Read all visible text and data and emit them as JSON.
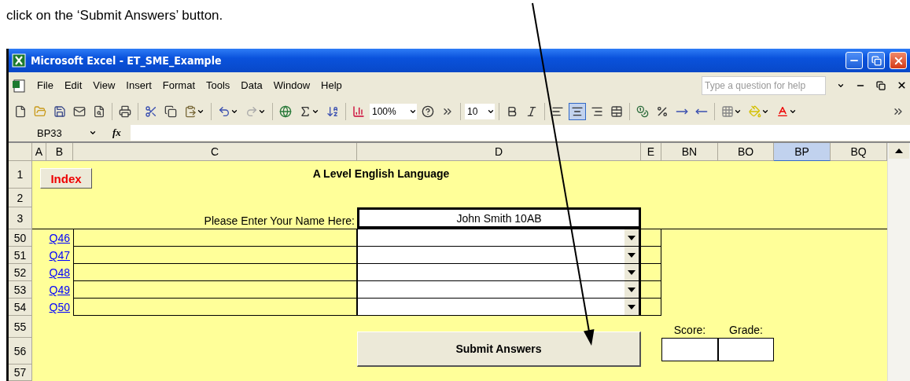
{
  "caption": "click on the ‘Submit Answers’ button.",
  "window": {
    "title": "Microsoft Excel - ET_SME_Example"
  },
  "menu": {
    "items": [
      "File",
      "Edit",
      "View",
      "Insert",
      "Format",
      "Tools",
      "Data",
      "Window",
      "Help"
    ],
    "help_placeholder": "Type a question for help"
  },
  "toolbar": {
    "zoom": "100%",
    "font_size": "10",
    "alignment": [
      {
        "selected": false
      },
      {
        "selected": true
      },
      {
        "selected": false
      }
    ]
  },
  "formula_bar": {
    "name_box": "BP33",
    "fx": "fx"
  },
  "columns": [
    {
      "label": "A",
      "selected": false
    },
    {
      "label": "B",
      "selected": false
    },
    {
      "label": "C",
      "selected": false
    },
    {
      "label": "D",
      "selected": false
    },
    {
      "label": "E",
      "selected": false
    },
    {
      "label": "BN",
      "selected": false
    },
    {
      "label": "BO",
      "selected": false
    },
    {
      "label": "BP",
      "selected": true
    },
    {
      "label": "BQ",
      "selected": false
    }
  ],
  "rows": [
    "1",
    "2",
    "3",
    "50",
    "51",
    "52",
    "53",
    "54",
    "55",
    "56",
    "57"
  ],
  "sheet": {
    "index_button": "Index",
    "heading": "A Level English Language",
    "name_label": "Please Enter Your Name Here:",
    "name_value": "John Smith 10AB",
    "questions": [
      {
        "link": "Q46"
      },
      {
        "link": "Q47"
      },
      {
        "link": "Q48"
      },
      {
        "link": "Q49"
      },
      {
        "link": "Q50"
      }
    ],
    "submit_button": "Submit Answers",
    "score_label": "Score:",
    "grade_label": "Grade:"
  }
}
